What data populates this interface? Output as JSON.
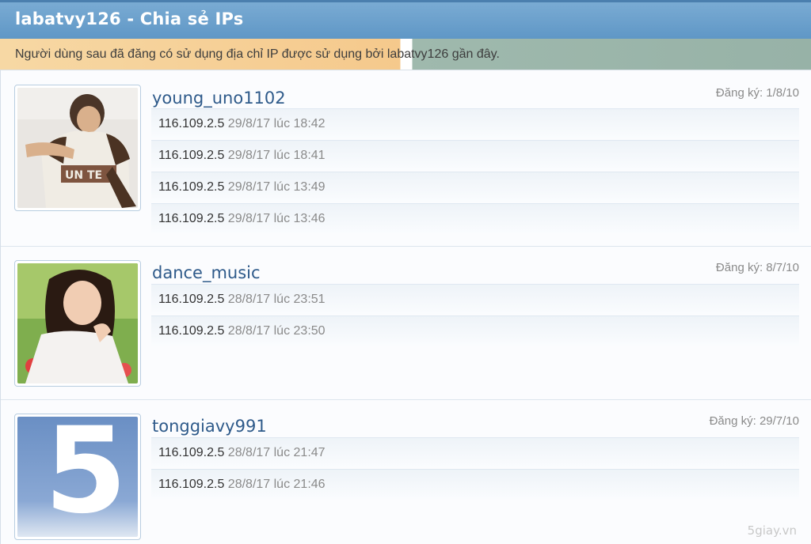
{
  "header": {
    "title": "labatvy126 - Chia sẻ IPs",
    "description": "Người dùng sau đã đăng có sử dụng địa chỉ IP được sử dụng bởi labatvy126 gần đây."
  },
  "members": [
    {
      "username": "young_uno1102",
      "registered": "Đăng ký: 1/8/10",
      "avatar": "photo-young-man",
      "entries": [
        {
          "ip": "116.109.2.5",
          "time": "29/8/17 lúc 18:42"
        },
        {
          "ip": "116.109.2.5",
          "time": "29/8/17 lúc 18:41"
        },
        {
          "ip": "116.109.2.5",
          "time": "29/8/17 lúc 13:49"
        },
        {
          "ip": "116.109.2.5",
          "time": "29/8/17 lúc 13:46"
        }
      ]
    },
    {
      "username": "dance_music",
      "registered": "Đăng ký: 8/7/10",
      "avatar": "photo-young-woman",
      "entries": [
        {
          "ip": "116.109.2.5",
          "time": "28/8/17 lúc 23:51"
        },
        {
          "ip": "116.109.2.5",
          "time": "28/8/17 lúc 23:50"
        }
      ]
    },
    {
      "username": "tonggiavy991",
      "registered": "Đăng ký: 29/7/10",
      "avatar": "number-5-avatar",
      "avatar_text": "5",
      "entries": [
        {
          "ip": "116.109.2.5",
          "time": "28/8/17 lúc 21:47"
        },
        {
          "ip": "116.109.2.5",
          "time": "28/8/17 lúc 21:46"
        }
      ]
    }
  ],
  "watermark": "5giay.vn",
  "colors": {
    "titlebar": "#6aa0cc",
    "username": "#2e5a8a",
    "muted": "#8a8a8a"
  }
}
